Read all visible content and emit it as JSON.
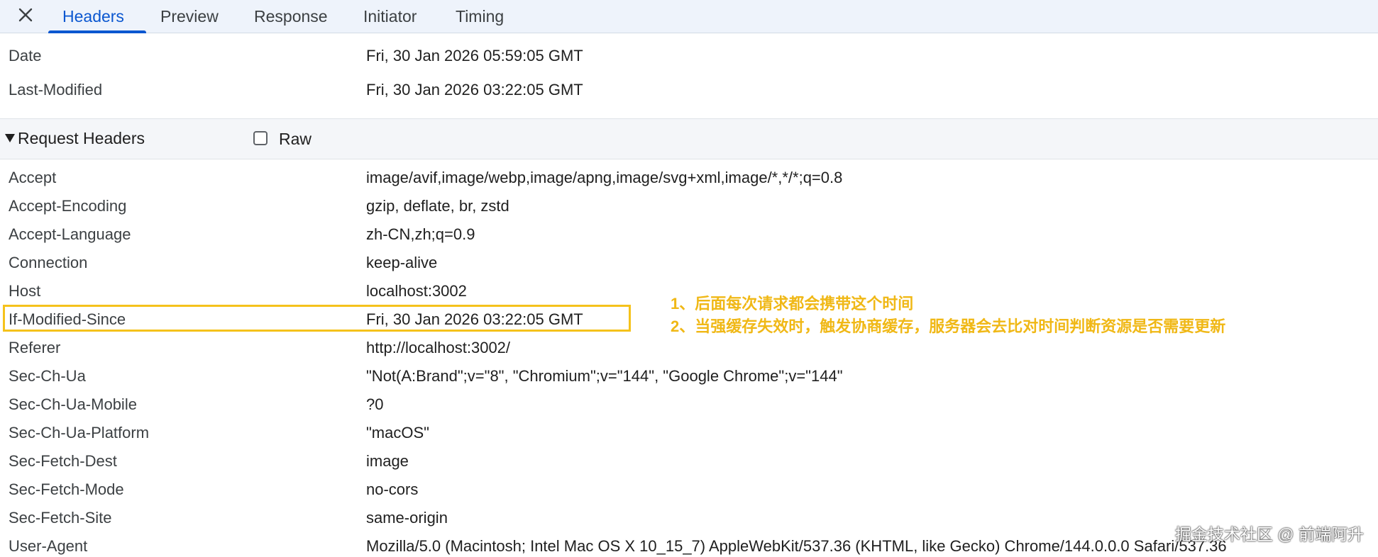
{
  "tabs": [
    {
      "label": "Headers",
      "active": true
    },
    {
      "label": "Preview",
      "active": false
    },
    {
      "label": "Response",
      "active": false
    },
    {
      "label": "Initiator",
      "active": false
    },
    {
      "label": "Timing",
      "active": false
    }
  ],
  "response_headers": [
    {
      "name": "Date",
      "value": "Fri, 30 Jan 2026 05:59:05 GMT"
    },
    {
      "name": "Last-Modified",
      "value": "Fri, 30 Jan 2026 03:22:05 GMT"
    }
  ],
  "request_section": {
    "title": "Request Headers",
    "raw_label": "Raw",
    "raw_checked": false
  },
  "request_headers": [
    {
      "name": "Accept",
      "value": "image/avif,image/webp,image/apng,image/svg+xml,image/*,*/*;q=0.8"
    },
    {
      "name": "Accept-Encoding",
      "value": "gzip, deflate, br, zstd"
    },
    {
      "name": "Accept-Language",
      "value": "zh-CN,zh;q=0.9"
    },
    {
      "name": "Connection",
      "value": "keep-alive"
    },
    {
      "name": "Host",
      "value": "localhost:3002"
    },
    {
      "name": "If-Modified-Since",
      "value": "Fri, 30 Jan 2026 03:22:05 GMT"
    },
    {
      "name": "Referer",
      "value": "http://localhost:3002/"
    },
    {
      "name": "Sec-Ch-Ua",
      "value": "\"Not(A:Brand\";v=\"8\", \"Chromium\";v=\"144\", \"Google Chrome\";v=\"144\""
    },
    {
      "name": "Sec-Ch-Ua-Mobile",
      "value": "?0"
    },
    {
      "name": "Sec-Ch-Ua-Platform",
      "value": "\"macOS\""
    },
    {
      "name": "Sec-Fetch-Dest",
      "value": "image"
    },
    {
      "name": "Sec-Fetch-Mode",
      "value": "no-cors"
    },
    {
      "name": "Sec-Fetch-Site",
      "value": "same-origin"
    },
    {
      "name": "User-Agent",
      "value": "Mozilla/5.0 (Macintosh; Intel Mac OS X 10_15_7) AppleWebKit/537.36 (KHTML, like Gecko) Chrome/144.0.0.0 Safari/537.36"
    }
  ],
  "annotations": [
    "1、后面每次请求都会携带这个时间",
    "2、当强缓存失效时，触发协商缓存，服务器会去比对时间判断资源是否需要更新"
  ],
  "watermark": "掘金技术社区 @ 前端阿升",
  "colors": {
    "accent": "#0b57d0",
    "highlight": "#f5c21b",
    "annotation": "#f0b816"
  },
  "icons": {
    "close": "close-icon",
    "expand": "triangle-down-icon"
  }
}
